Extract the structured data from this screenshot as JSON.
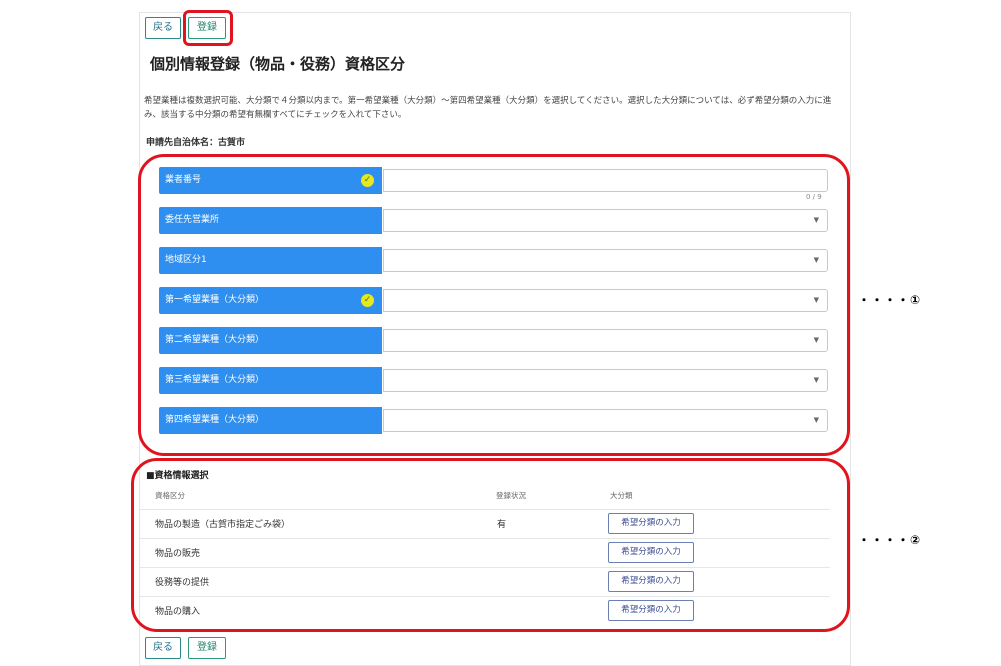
{
  "top_buttons": {
    "back": "戻る",
    "register": "登録"
  },
  "title": "個別情報登録（物品・役務）資格区分",
  "description": "希望業種は複数選択可能、大分類で４分類以内まで。第一希望業種（大分類）～第四希望業種（大分類）を選択してください。選択した大分類については、必ず希望分類の入力に進み、該当する中分類の希望有無欄すべてにチェックを入れて下さい。",
  "municipality": "申請先自治体名：古賀市",
  "form_rows": [
    {
      "label": "業者番号",
      "check": true,
      "type": "text"
    },
    {
      "label": "委任先営業所",
      "check": false,
      "type": "select"
    },
    {
      "label": "地域区分1",
      "check": false,
      "type": "select"
    },
    {
      "label": "第一希望業種（大分類）",
      "check": true,
      "type": "select"
    },
    {
      "label": "第二希望業種（大分類）",
      "check": false,
      "type": "select"
    },
    {
      "label": "第三希望業種（大分類）",
      "check": false,
      "type": "select"
    },
    {
      "label": "第四希望業種（大分類）",
      "check": false,
      "type": "select"
    }
  ],
  "counter": "0 / 9",
  "section": {
    "title": "■資格情報選択",
    "headers": {
      "qualification": "資格区分",
      "status": "登録状況",
      "major": "大分類"
    },
    "rows": [
      {
        "name": "物品の製造（古賀市指定ごみ袋）",
        "status": "有",
        "button": "希望分類の入力"
      },
      {
        "name": "物品の販売",
        "status": "",
        "button": "希望分類の入力"
      },
      {
        "name": "役務等の提供",
        "status": "",
        "button": "希望分類の入力"
      },
      {
        "name": "物品の購入",
        "status": "",
        "button": "希望分類の入力"
      }
    ]
  },
  "bottom_buttons": {
    "back": "戻る",
    "register": "登録"
  },
  "markers": {
    "one": "・・・・①",
    "two": "・・・・②"
  },
  "colors": {
    "label_bg": "#2f8ff0",
    "highlight": "#e0141e",
    "check": "#e8e81c"
  }
}
